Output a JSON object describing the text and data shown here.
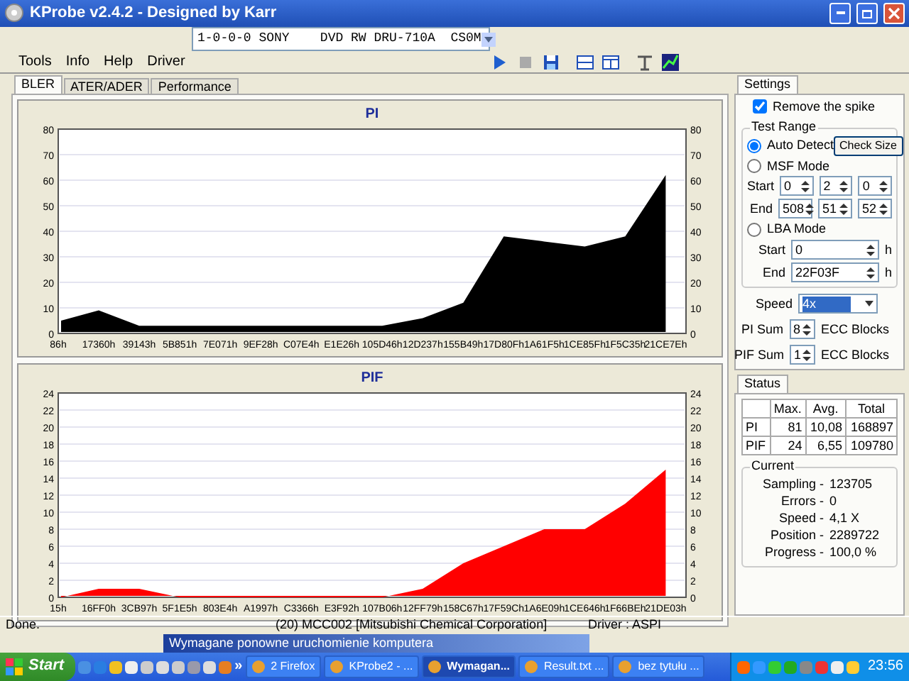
{
  "window": {
    "title": "KProbe v2.4.2 - Designed by Karr"
  },
  "drive_select": {
    "value": "1-0-0-0 SONY    DVD RW DRU-710A  CS0M"
  },
  "menu": [
    "Tools",
    "Info",
    "Help",
    "Driver"
  ],
  "tabs": [
    {
      "label": "BLER",
      "selected": true
    },
    {
      "label": "ATER/ADER",
      "selected": false
    },
    {
      "label": "Performance",
      "selected": false
    }
  ],
  "charts": [
    {
      "right_axis_labels": [
        "80",
        "70",
        "60",
        "50",
        "40",
        "30",
        "20",
        "10",
        "0"
      ],
      "chart_data": {
        "type": "area",
        "title": "PI",
        "grid": true,
        "categories": [
          "86h",
          "17360h",
          "39143h",
          "5B851h",
          "7E071h",
          "9EF28h",
          "C07E4h",
          "E1E26h",
          "105D46h",
          "12D237h",
          "155B49h",
          "17D80Fh",
          "1A61F5h",
          "1CE85Fh",
          "1F5C35h",
          "21CE7Eh"
        ],
        "ylim": [
          0,
          80
        ],
        "yticks": [
          0,
          10,
          20,
          30,
          40,
          50,
          60,
          70,
          80
        ],
        "series": [
          {
            "color": "#000000",
            "values": [
              5,
              9,
              3,
              3,
              3,
              3,
              3,
              3,
              3,
              6,
              12,
              38,
              36,
              34,
              38,
              62
            ]
          }
        ]
      }
    },
    {
      "right_axis_labels": [
        "24",
        "22",
        "20",
        "18",
        "16",
        "14",
        "12",
        "10",
        "8",
        "6",
        "4",
        "2",
        "0"
      ],
      "chart_data": {
        "type": "area",
        "title": "PIF",
        "grid": true,
        "categories": [
          "15h",
          "16FF0h",
          "3CB97h",
          "5F1E5h",
          "803E4h",
          "A1997h",
          "C3366h",
          "E3F92h",
          "107B06h",
          "12FF79h",
          "158C67h",
          "17F59Ch",
          "1A6E09h",
          "1CE646h",
          "1F66BEh",
          "21DE03h"
        ],
        "ylim": [
          0,
          24
        ],
        "yticks": [
          0,
          2,
          4,
          6,
          8,
          10,
          12,
          14,
          16,
          18,
          20,
          22,
          24
        ],
        "series": [
          {
            "color": "#ff0000",
            "values": [
              0,
              1,
              1,
              0,
              0,
              0,
              0,
              0,
              0,
              1,
              4,
              6,
              8,
              8,
              11,
              15
            ]
          }
        ]
      }
    }
  ],
  "settings": {
    "tab": "Settings",
    "remove_spike": {
      "label": "Remove the spike",
      "checked": true
    },
    "test_range": {
      "legend": "Test Range",
      "check_size": "Check Size",
      "modes": [
        {
          "label": "Auto Detect",
          "selected": true
        },
        {
          "label": "MSF Mode",
          "selected": false
        },
        {
          "label": "LBA Mode",
          "selected": false
        }
      ],
      "msf_start": {
        "label": "Start",
        "values": [
          "0",
          "2",
          "0"
        ]
      },
      "msf_end": {
        "label": "End",
        "values": [
          "508",
          "51",
          "52"
        ]
      },
      "lba_start": {
        "label": "Start",
        "value": "0",
        "unit": "h"
      },
      "lba_end": {
        "label": "End",
        "value": "22F03F",
        "unit": "h"
      }
    },
    "speed": {
      "label": "Speed",
      "value": "4x"
    },
    "pi_sum": {
      "label": "PI Sum",
      "value": "8",
      "unit": "ECC Blocks"
    },
    "pif_sum": {
      "label": "PIF Sum",
      "value": "1",
      "unit": "ECC Blocks"
    }
  },
  "status": {
    "tab": "Status",
    "columns": [
      "Max.",
      "Avg.",
      "Total"
    ],
    "rows": [
      {
        "label": "PI",
        "values": [
          "81",
          "10,08",
          "168897"
        ]
      },
      {
        "label": "PIF",
        "values": [
          "24",
          "6,55",
          "109780"
        ]
      }
    ],
    "current": {
      "legend": "Current",
      "items": [
        {
          "label": "Sampling -",
          "value": "123705"
        },
        {
          "label": "Errors -",
          "value": "0"
        },
        {
          "label": "Speed -",
          "value": "4,1  X"
        },
        {
          "label": "Position -",
          "value": "2289722"
        },
        {
          "label": "Progress -",
          "value": "100,0 %"
        }
      ]
    }
  },
  "status_bar": [
    "Done.",
    "(20) MCC002 [Mitsubishi Chemical Corporation]",
    "Driver : ASPI"
  ],
  "notification": "Wymagane ponowne uruchomienie komputera",
  "taskbar": {
    "start": "Start",
    "overflow": "»",
    "clock": "23:56",
    "tasks": [
      {
        "label": "2 Firefox",
        "selected": false
      },
      {
        "label": "KProbe2 - ...",
        "selected": false
      },
      {
        "label": "Wymagan...",
        "selected": true
      },
      {
        "label": "Result.txt ...",
        "selected": false
      },
      {
        "label": "bez tytułu ...",
        "selected": false
      }
    ]
  }
}
